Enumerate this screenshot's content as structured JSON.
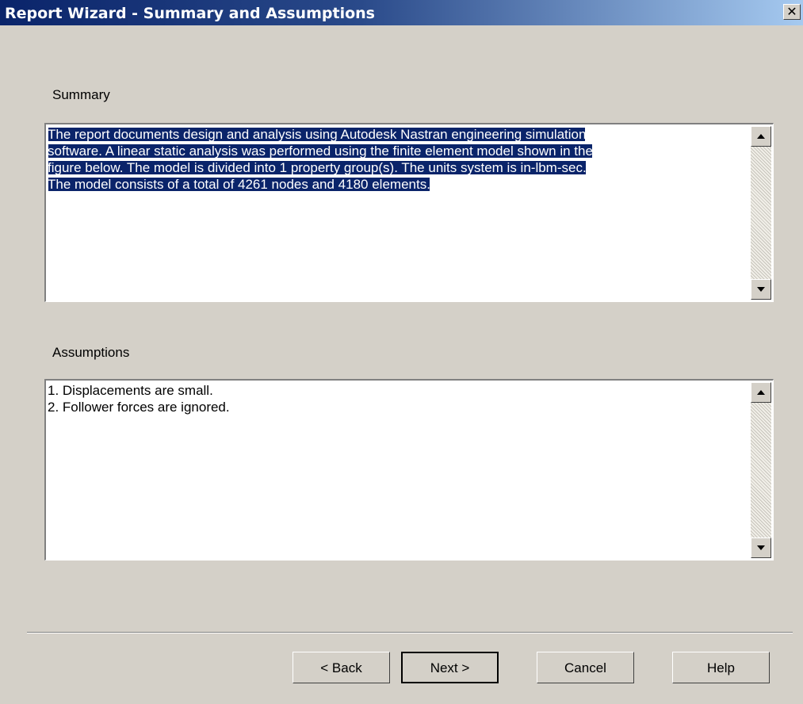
{
  "window": {
    "title": "Report Wizard - Summary and Assumptions",
    "close_glyph": "✕"
  },
  "summary": {
    "label": "Summary",
    "lines": [
      "The report documents design and analysis using Autodesk Nastran engineering simulation",
      "software. A linear static analysis was performed using the finite element model shown in the",
      "figure below. The model is divided into 1 property group(s). The units system is in-lbm-sec.",
      "The model consists of a total of 4261 nodes and 4180 elements."
    ]
  },
  "assumptions": {
    "label": "Assumptions",
    "lines": [
      "1. Displacements are small.",
      "2. Follower forces are ignored."
    ]
  },
  "buttons": {
    "back": "< Back",
    "next": "Next >",
    "cancel": "Cancel",
    "help": "Help"
  },
  "icons": {
    "close": "close-icon",
    "scroll_up": "scroll-up-arrow-icon",
    "scroll_down": "scroll-down-arrow-icon"
  },
  "colors": {
    "title_bar_start": "#0a246a",
    "title_bar_end": "#a6caf0",
    "selection": "#0a246a",
    "dialog_bg": "#d4d0c8"
  }
}
